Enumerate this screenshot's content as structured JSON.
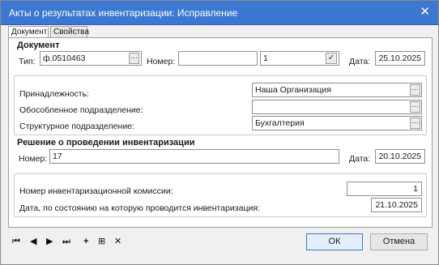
{
  "window": {
    "title": "Акты о результатах инвентаризации: Исправление",
    "close_glyph": "✕"
  },
  "tabs": [
    {
      "label": "Документ"
    },
    {
      "label": "Свойства"
    }
  ],
  "document": {
    "section_title": "Документ",
    "type_label": "Тип:",
    "type_value": "ф.0510463",
    "number_label": "Номер:",
    "number_prefix_value": "",
    "number_value": "1",
    "date_label": "Дата:",
    "date_value": "25.10.2025"
  },
  "belonging": {
    "org_label": "Принадлежность:",
    "org_value": "Наша Организация",
    "separate_label": "Обособленное подразделение:",
    "separate_value": "",
    "structural_label": "Структурное подразделение:",
    "structural_value": "Бухгалтерия"
  },
  "decision": {
    "section_title": "Решение о проведении инвентаризации",
    "number_label": "Номер:",
    "number_value": "17",
    "date_label": "Дата:",
    "date_value": "20.10.2025"
  },
  "commission": {
    "number_label": "Номер инвентаризационной комиссии:",
    "number_value": "1",
    "state_date_label": "Дата, по состоянию на которую проводится инвентаризация:",
    "state_date_value": "21.10.2025"
  },
  "buttons": {
    "ok": "ОК",
    "cancel": "Отмена",
    "dots": "···",
    "check": "✓"
  },
  "nav": {
    "first": "⏮",
    "prev": "◀",
    "next": "▶",
    "last": "⏭",
    "add": "+",
    "add_copy": "⊞",
    "delete": "✕"
  }
}
